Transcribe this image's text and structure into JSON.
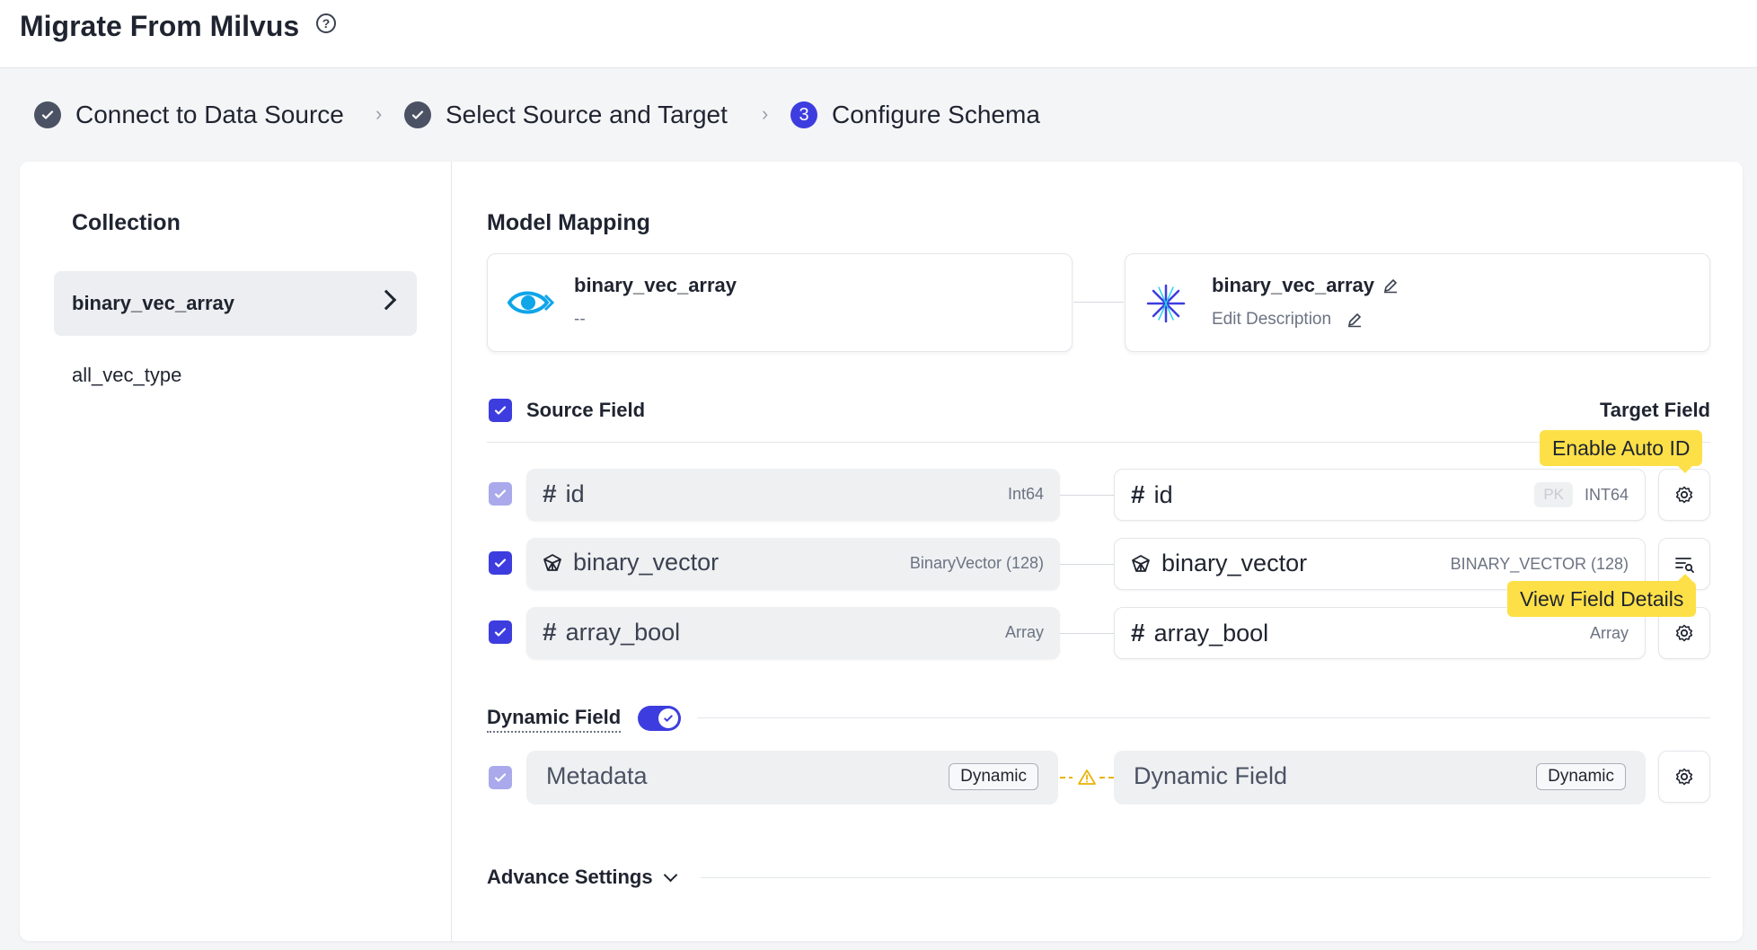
{
  "header": {
    "title": "Migrate From Milvus",
    "help_icon": "question-circle-icon"
  },
  "stepper": {
    "steps": [
      {
        "label": "Connect to Data Source",
        "status": "done"
      },
      {
        "label": "Select Source and Target",
        "status": "done"
      },
      {
        "label": "Configure Schema",
        "status": "active",
        "number": "3"
      }
    ]
  },
  "sidebar": {
    "title": "Collection",
    "items": [
      {
        "label": "binary_vec_array",
        "active": true
      },
      {
        "label": "all_vec_type",
        "active": false
      }
    ]
  },
  "model_mapping": {
    "title": "Model Mapping",
    "source": {
      "name": "binary_vec_array",
      "description": "--",
      "icon": "milvus-eye-icon"
    },
    "target": {
      "name": "binary_vec_array",
      "description": "Edit Description",
      "icon": "zilliz-star-icon"
    }
  },
  "fields": {
    "source_header": "Source Field",
    "target_header": "Target Field",
    "rows": [
      {
        "source_name": "id",
        "source_type": "Int64",
        "target_name": "id",
        "target_type": "INT64",
        "pk": "PK",
        "icon": "hash-icon",
        "action_icon": "gear-icon"
      },
      {
        "source_name": "binary_vector",
        "source_type": "BinaryVector (128)",
        "target_name": "binary_vector",
        "target_type": "BINARY_VECTOR (128)",
        "icon": "vector-icon",
        "action_icon": "field-details-icon"
      },
      {
        "source_name": "array_bool",
        "source_type": "Array",
        "target_name": "array_bool",
        "target_type": "Array",
        "icon": "hash-icon",
        "action_icon": "gear-icon"
      }
    ]
  },
  "tooltips": {
    "enable_auto_id": "Enable Auto ID",
    "view_field_details": "View Field Details"
  },
  "dynamic": {
    "label": "Dynamic Field",
    "enabled": true,
    "source_name": "Metadata",
    "source_badge": "Dynamic",
    "target_name": "Dynamic Field",
    "target_badge": "Dynamic"
  },
  "advance_settings": {
    "label": "Advance Settings"
  },
  "colors": {
    "accent": "#3d3ddf",
    "tooltip": "#fde047",
    "warning": "#eab308"
  }
}
